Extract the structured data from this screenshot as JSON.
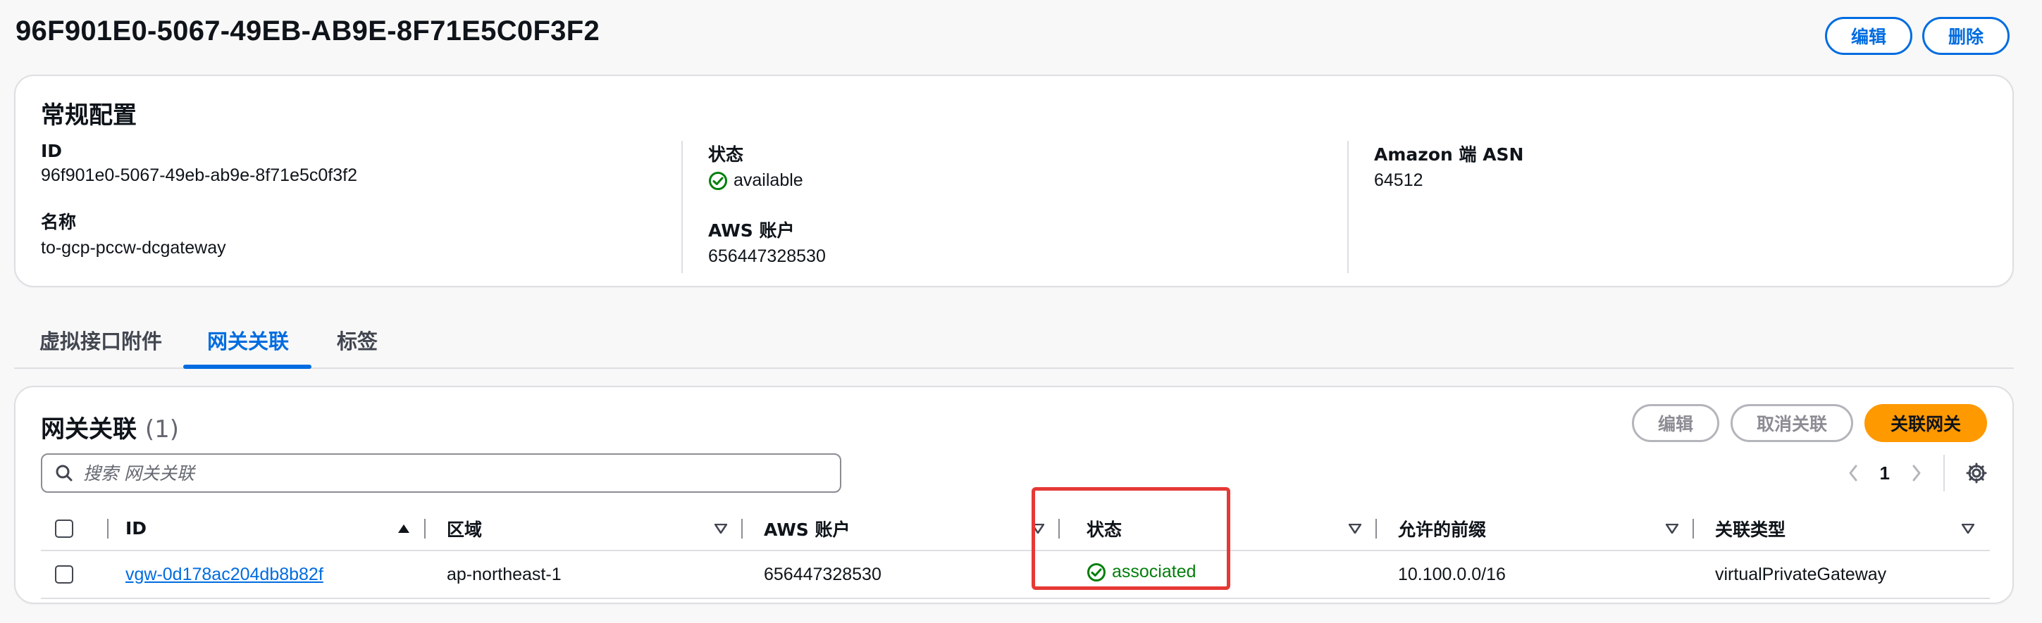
{
  "page": {
    "title": "96F901E0-5067-49EB-AB9E-8F71E5C0F3F2"
  },
  "header_actions": {
    "edit_label": "编辑",
    "delete_label": "删除"
  },
  "general_config": {
    "title": "常规配置",
    "fields": {
      "id": {
        "label": "ID",
        "value": "96f901e0-5067-49eb-ab9e-8f71e5c0f3f2"
      },
      "name": {
        "label": "名称",
        "value": "to-gcp-pccw-dcgateway"
      },
      "status": {
        "label": "状态",
        "value": "available"
      },
      "aws_account": {
        "label": "AWS 账户",
        "value": "656447328530"
      },
      "amazon_asn": {
        "label": "Amazon 端 ASN",
        "value": "64512"
      }
    }
  },
  "tabs": [
    {
      "label": "虚拟接口附件"
    },
    {
      "label": "网关关联",
      "active": true
    },
    {
      "label": "标签"
    }
  ],
  "associations": {
    "title": "网关关联",
    "count": "(1)",
    "actions": {
      "edit_label": "编辑",
      "disassociate_label": "取消关联",
      "associate_label": "关联网关"
    },
    "search_placeholder": "搜索 网关关联",
    "pagination": {
      "current_page": "1"
    },
    "columns": [
      "ID",
      "区域",
      "AWS 账户",
      "状态",
      "允许的前缀",
      "关联类型"
    ],
    "rows": [
      {
        "id": "vgw-0d178ac204db8b82f",
        "region": "ap-northeast-1",
        "aws_account": "656447328530",
        "status": "associated",
        "allowed_prefixes": "10.100.0.0/16",
        "association_type": "virtualPrivateGateway"
      }
    ]
  },
  "colors": {
    "accent": "#006ce0",
    "success": "#037f0c",
    "primary_button": "#ff9900",
    "highlight": "#e53935"
  }
}
